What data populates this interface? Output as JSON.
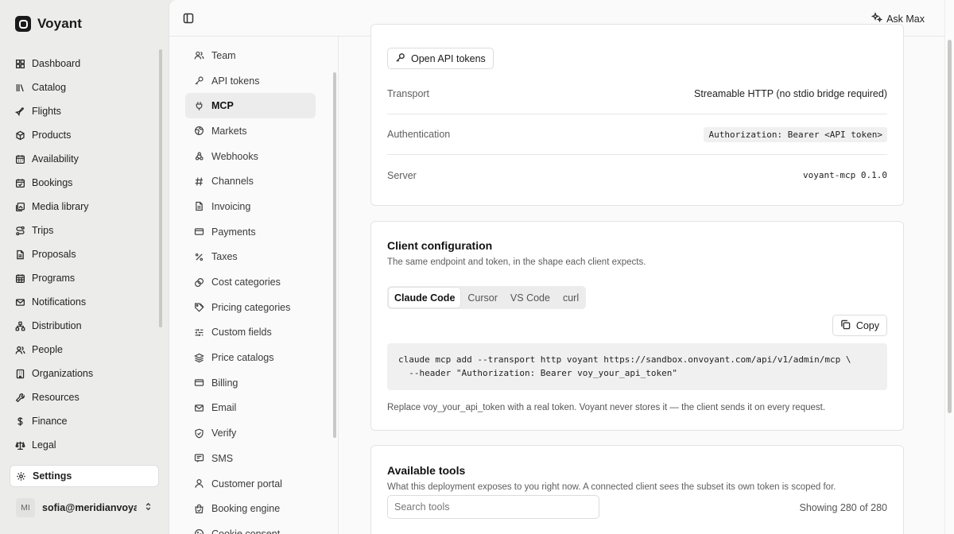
{
  "brand": {
    "name": "Voyant"
  },
  "sidebar": {
    "items": [
      {
        "label": "Dashboard",
        "icon": "dashboard-icon"
      },
      {
        "label": "Catalog",
        "icon": "catalog-icon"
      },
      {
        "label": "Flights",
        "icon": "plane-icon"
      },
      {
        "label": "Products",
        "icon": "package-icon"
      },
      {
        "label": "Availability",
        "icon": "calendar-icon"
      },
      {
        "label": "Bookings",
        "icon": "calendar-check-icon"
      },
      {
        "label": "Media library",
        "icon": "images-icon"
      },
      {
        "label": "Trips",
        "icon": "route-icon"
      },
      {
        "label": "Proposals",
        "icon": "document-icon"
      },
      {
        "label": "Programs",
        "icon": "calendar-grid-icon"
      },
      {
        "label": "Notifications",
        "icon": "mail-icon"
      },
      {
        "label": "Distribution",
        "icon": "network-icon"
      },
      {
        "label": "People",
        "icon": "users-icon"
      },
      {
        "label": "Organizations",
        "icon": "building-icon"
      },
      {
        "label": "Resources",
        "icon": "wrench-icon"
      },
      {
        "label": "Finance",
        "icon": "dollar-icon"
      },
      {
        "label": "Legal",
        "icon": "scales-icon"
      }
    ],
    "settings_label": "Settings",
    "user": {
      "initials": "MI",
      "email": "sofia@meridianvoya..."
    }
  },
  "topbar": {
    "ask_label": "Ask Max"
  },
  "subnav": {
    "items": [
      {
        "label": "Team"
      },
      {
        "label": "API tokens"
      },
      {
        "label": "MCP",
        "active": true
      },
      {
        "label": "Markets"
      },
      {
        "label": "Webhooks"
      },
      {
        "label": "Channels"
      },
      {
        "label": "Invoicing"
      },
      {
        "label": "Payments"
      },
      {
        "label": "Taxes"
      },
      {
        "label": "Cost categories"
      },
      {
        "label": "Pricing categories"
      },
      {
        "label": "Custom fields"
      },
      {
        "label": "Price catalogs"
      },
      {
        "label": "Billing"
      },
      {
        "label": "Email"
      },
      {
        "label": "Verify"
      },
      {
        "label": "SMS"
      },
      {
        "label": "Customer portal"
      },
      {
        "label": "Booking engine"
      },
      {
        "label": "Cookie consent"
      }
    ]
  },
  "connection": {
    "open_tokens_label": "Open API tokens",
    "rows": [
      {
        "label": "Transport",
        "value": "Streamable HTTP (no stdio bridge required)"
      },
      {
        "label": "Authentication",
        "value": "Authorization: Bearer <API token>"
      },
      {
        "label": "Server",
        "value": "voyant-mcp 0.1.0"
      }
    ]
  },
  "client_config": {
    "title": "Client configuration",
    "subtitle": "The same endpoint and token, in the shape each client expects.",
    "tabs": [
      "Claude Code",
      "Cursor",
      "VS Code",
      "curl"
    ],
    "copy_label": "Copy",
    "code_line1": "claude mcp add --transport http voyant https://sandbox.onvoyant.com/api/v1/admin/mcp \\",
    "code_line2": "  --header \"Authorization: Bearer voy_your_api_token\"",
    "footnote": "Replace voy_your_api_token with a real token. Voyant never stores it — the client sends it on every request."
  },
  "tools": {
    "title": "Available tools",
    "subtitle": "What this deployment exposes to you right now. A connected client sees the subset its own token is scoped for.",
    "search_placeholder": "Search tools",
    "showing": "Showing 280 of 280"
  }
}
